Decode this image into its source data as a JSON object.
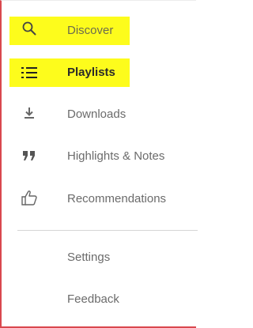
{
  "menu": {
    "items": [
      {
        "label": "Discover",
        "icon": "search-icon",
        "highlighted": true
      },
      {
        "label": "Playlists",
        "icon": "list-icon",
        "highlighted": true,
        "active": true
      },
      {
        "label": "Downloads",
        "icon": "download-icon"
      },
      {
        "label": "Highlights & Notes",
        "icon": "quote-icon"
      },
      {
        "label": "Recommendations",
        "icon": "thumbs-up-icon"
      }
    ],
    "secondary": [
      {
        "label": "Settings"
      },
      {
        "label": "Feedback"
      }
    ]
  },
  "colors": {
    "highlight": "#fdfc1c",
    "frame_border": "#d9484e",
    "text": "#6b6b6b",
    "text_active": "#2a2a2a",
    "icon": "#6b6b6b"
  }
}
